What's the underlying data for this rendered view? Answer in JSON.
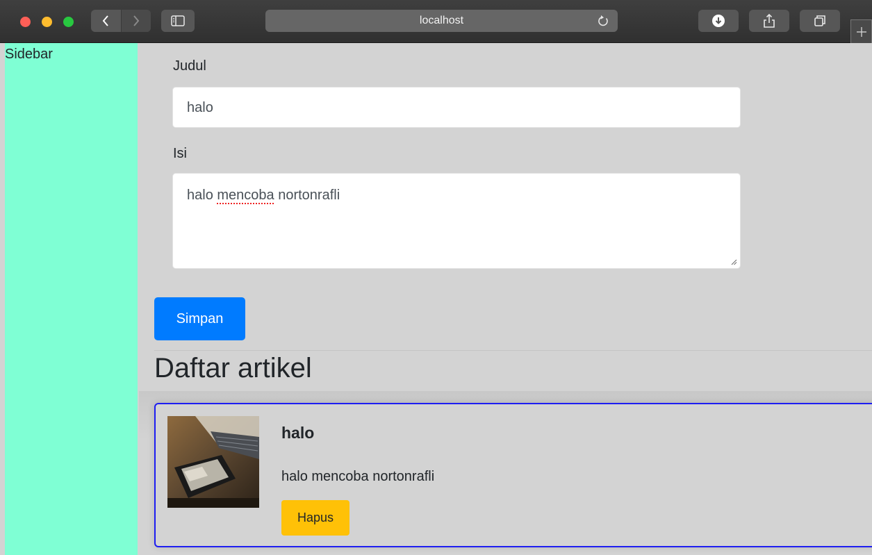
{
  "browser": {
    "address": "localhost",
    "icons": {
      "back": "chevron-left-icon",
      "forward": "chevron-right-icon",
      "sidebar": "sidebar-icon",
      "reload": "reload-icon",
      "downloads": "download-icon",
      "share": "share-icon",
      "tabs": "tabs-overview-icon",
      "new_tab": "plus-icon"
    }
  },
  "sidebar": {
    "title": "Sidebar"
  },
  "form": {
    "title_label": "Judul",
    "title_value": "halo",
    "content_label": "Isi",
    "content_value_before": "halo ",
    "content_value_misspelled": "mencoba",
    "content_value_after": " nortonrafli",
    "save_label": "Simpan"
  },
  "articles": {
    "heading": "Daftar artikel",
    "items": [
      {
        "title": "halo",
        "body": "halo mencoba nortonrafli",
        "delete_label": "Hapus"
      }
    ]
  },
  "colors": {
    "sidebar_bg": "#7fffd4",
    "page_bg": "#d3d3d3",
    "primary": "#007bff",
    "warning": "#ffc107",
    "card_border": "#1d1df2"
  }
}
